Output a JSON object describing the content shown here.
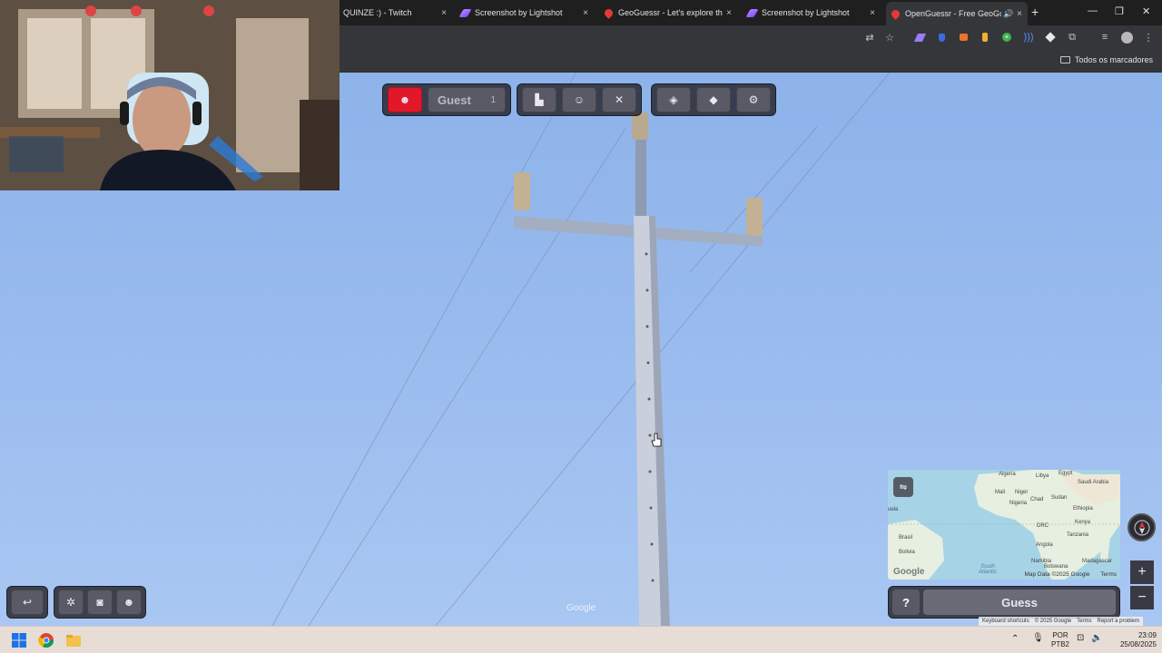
{
  "browser": {
    "tabs": [
      {
        "title": "QUINZE :) - Twitch",
        "favicon": "twitch-icon"
      },
      {
        "title": "Screenshot by Lightshot",
        "favicon": "lightshot-icon"
      },
      {
        "title": "GeoGuessr - Let's explore the w",
        "favicon": "geoguessr-icon"
      },
      {
        "title": "Screenshot by Lightshot",
        "favicon": "lightshot-icon"
      },
      {
        "title": "OpenGuessr - Free GeoGue",
        "favicon": "openguessr-icon",
        "active": true
      }
    ],
    "tab_close_glyph": "×",
    "new_tab_glyph": "+",
    "window_controls": {
      "minimize": "—",
      "maximize": "❐",
      "close": "✕"
    },
    "bookmarks_folder": "Todos os marcadores"
  },
  "hud": {
    "player_name": "Guest",
    "player_count": "1",
    "guess_label": "Guess",
    "help_label": "?"
  },
  "minimap": {
    "labels": [
      "Algeria",
      "Libya",
      "Egypt",
      "Saudi Arabia",
      "Mali",
      "Niger",
      "Chad",
      "Sudan",
      "Nigeria",
      "Ethiopia",
      "DRC",
      "Kenya",
      "Tanzania",
      "Angola",
      "Namibia",
      "Botswana",
      "Madagascar",
      "South Atlantic",
      "Brasil",
      "Bolivia",
      "uela"
    ],
    "attribution": "Map Data ©2025 Google",
    "terms": "Terms",
    "google_logo": "Google"
  },
  "streetview": {
    "watermark": "Google",
    "footer": [
      "Keyboard shortcuts",
      "© 2025 Google",
      "Terms",
      "Report a problem"
    ]
  },
  "taskbar": {
    "lang_top": "POR",
    "lang_bottom": "PTB2",
    "time": "23:09",
    "date": "25/08/2025"
  },
  "colors": {
    "accent_red": "#e0182a",
    "hud_bg": "#282832",
    "sky": "#98baee"
  }
}
